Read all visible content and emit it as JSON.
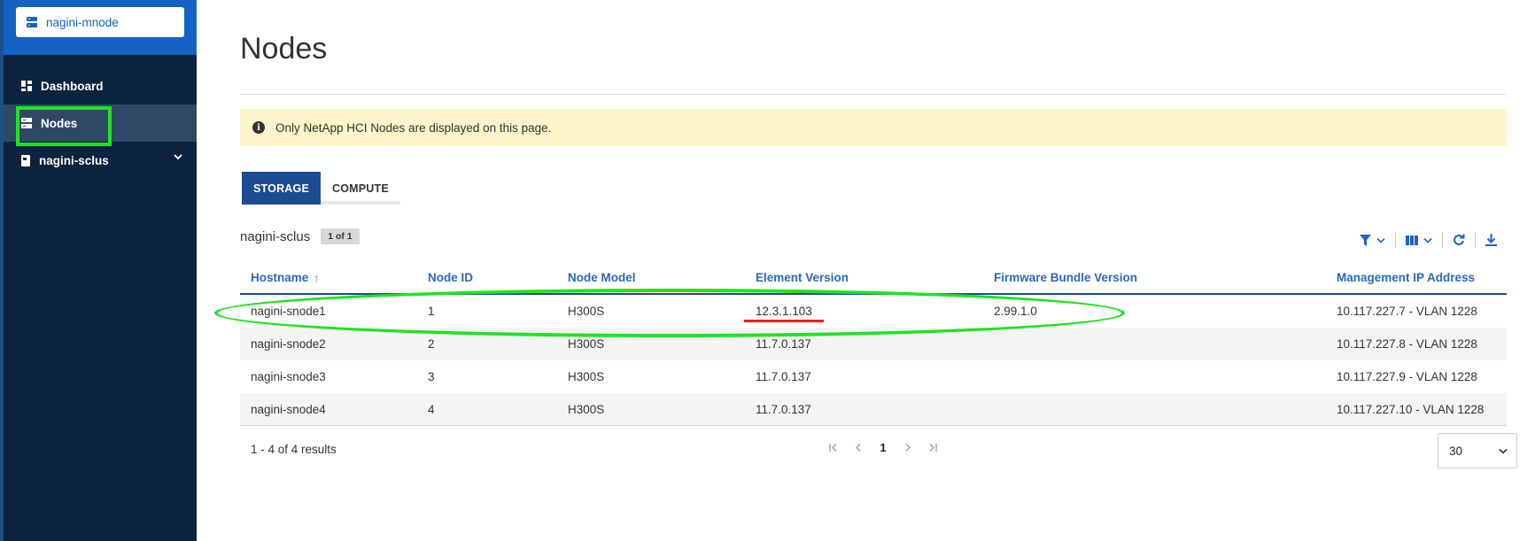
{
  "sidebar": {
    "app_name": "nagini-mnode",
    "items": [
      {
        "label": "Dashboard"
      },
      {
        "label": "Nodes"
      },
      {
        "label": "nagini-sclus"
      }
    ]
  },
  "page": {
    "title": "Nodes",
    "notice": "Only NetApp HCI Nodes are displayed on this page."
  },
  "tabs": [
    {
      "label": "STORAGE",
      "active": true
    },
    {
      "label": "COMPUTE",
      "active": false
    }
  ],
  "cluster": {
    "name": "nagini-sclus",
    "page_badge": "1 of 1"
  },
  "table": {
    "columns": [
      "Hostname",
      "Node ID",
      "Node Model",
      "Element Version",
      "Firmware Bundle Version",
      "Management IP Address"
    ],
    "sort_indicator": "↑",
    "rows": [
      [
        "nagini-snode1",
        "1",
        "H300S",
        "12.3.1.103",
        "2.99.1.0",
        "10.117.227.7 - VLAN 1228"
      ],
      [
        "nagini-snode2",
        "2",
        "H300S",
        "11.7.0.137",
        "",
        "10.117.227.8 - VLAN 1228"
      ],
      [
        "nagini-snode3",
        "3",
        "H300S",
        "11.7.0.137",
        "",
        "10.117.227.9 - VLAN 1228"
      ],
      [
        "nagini-snode4",
        "4",
        "H300S",
        "11.7.0.137",
        "",
        "10.117.227.10 - VLAN 1228"
      ]
    ]
  },
  "footer": {
    "results": "1 - 4 of 4 results",
    "current_page": "1",
    "page_size": "30"
  },
  "colors": {
    "sidebar_bg": "#0c2340",
    "sidebar_header": "#1463c4",
    "accent": "#1c4b91",
    "annotation_green": "#21e220",
    "annotation_red": "#e6241a"
  }
}
